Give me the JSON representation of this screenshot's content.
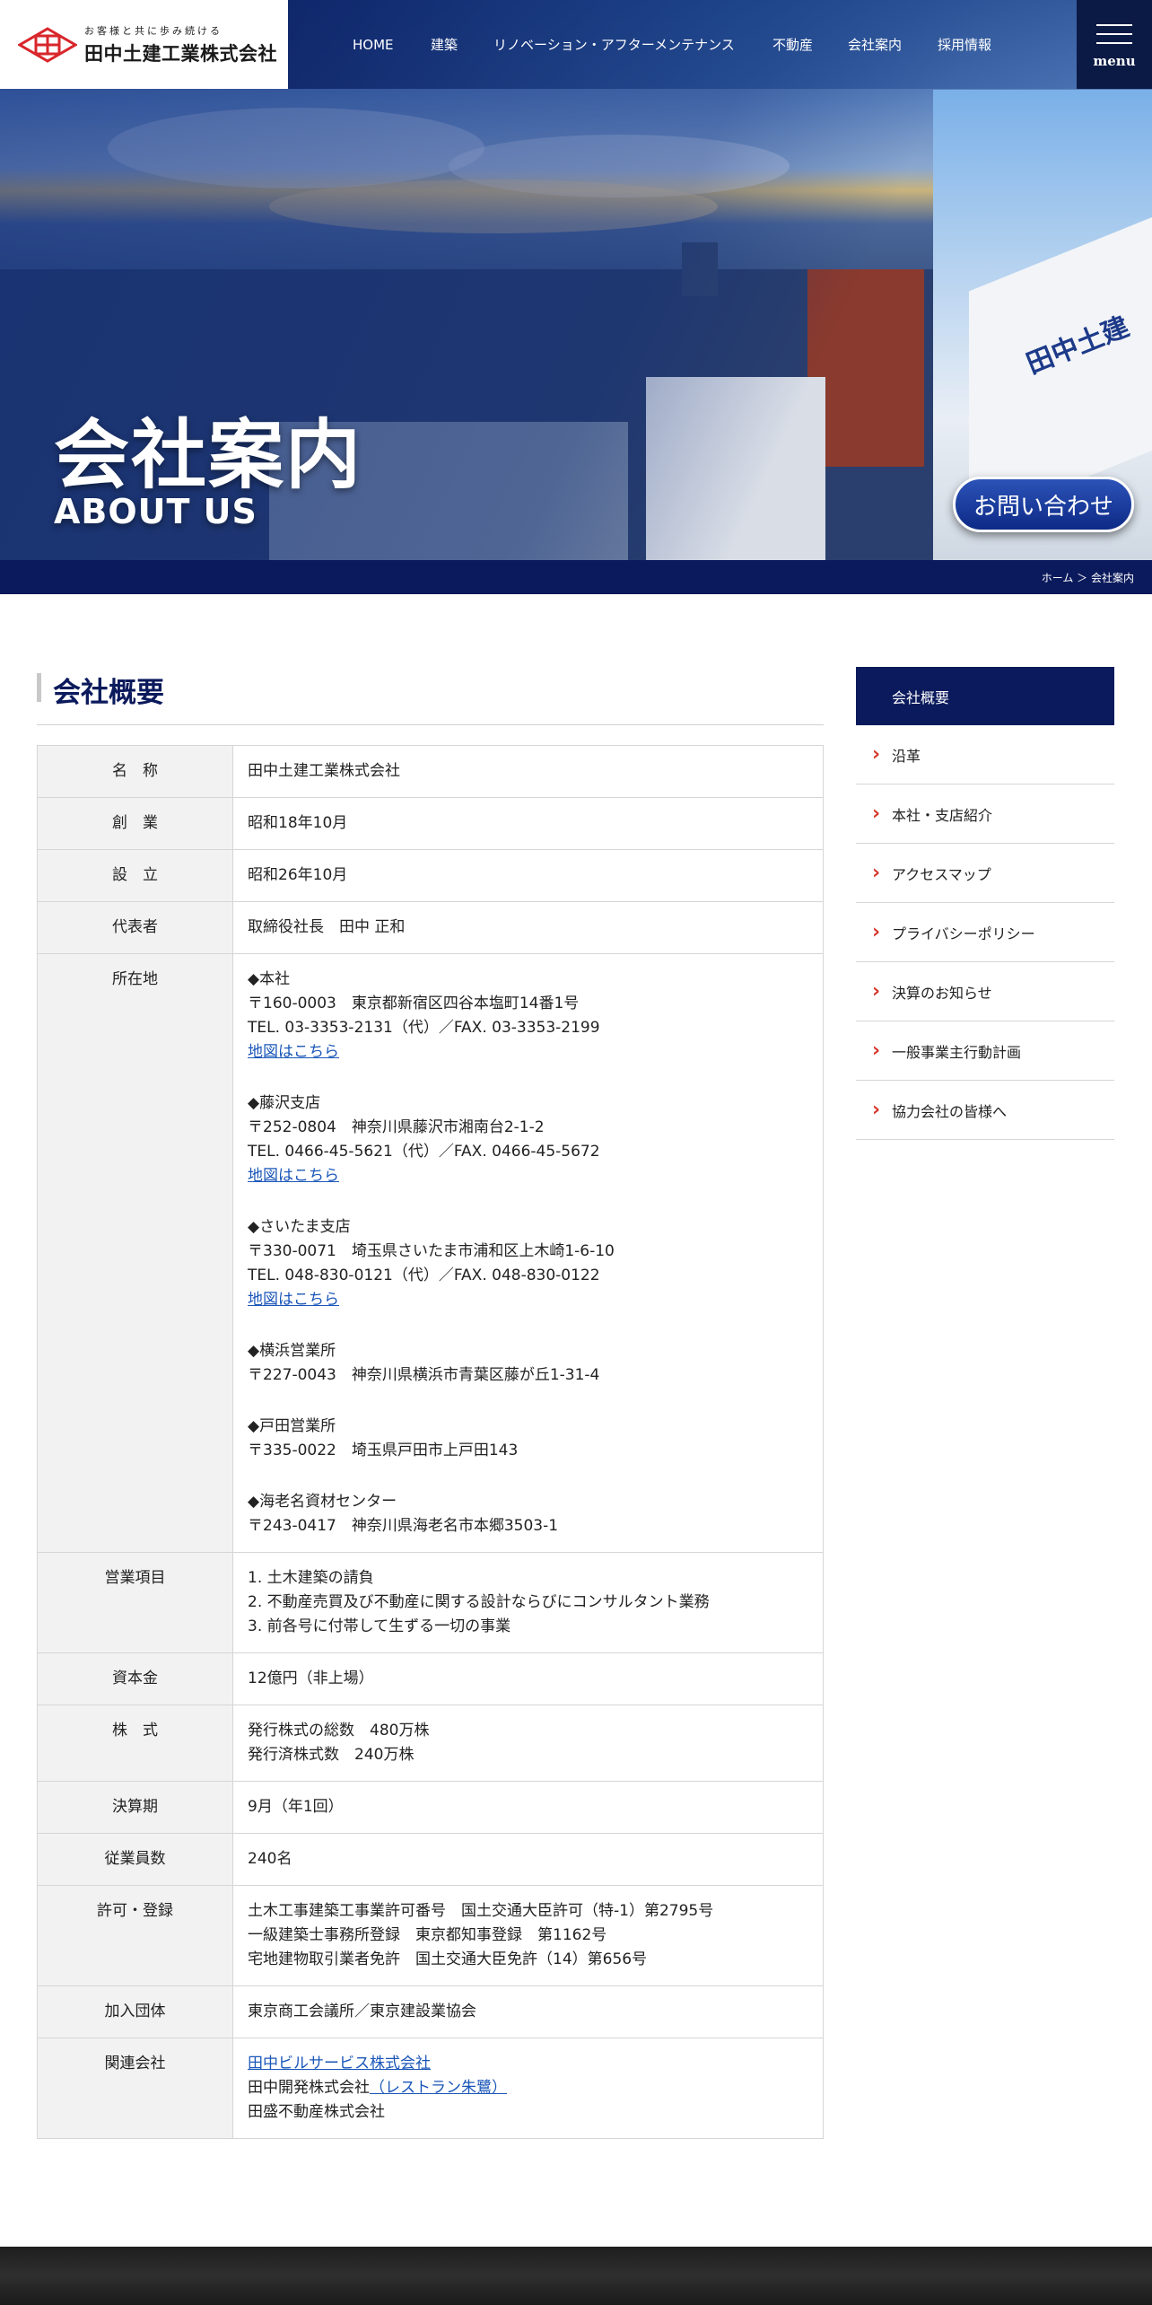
{
  "header": {
    "logo_tagline": "お客様と共に歩み続ける",
    "logo_name": "田中土建工業株式会社",
    "nav": [
      "HOME",
      "建築",
      "リノベーション・アフターメンテナンス",
      "不動産",
      "会社案内",
      "採用情報"
    ],
    "menu_label": "menu"
  },
  "hero": {
    "title_ja": "会社案内",
    "title_en": "ABOUT US",
    "building_sign": "田中土建",
    "contact_button": "お問い合わせ"
  },
  "breadcrumb": "ホーム ＞ 会社案内",
  "section_title": "会社概要",
  "table": {
    "name_label": "名　称",
    "name_value": "田中土建工業株式会社",
    "founded_label": "創　業",
    "founded_value": "昭和18年10月",
    "established_label": "設　立",
    "established_value": "昭和26年10月",
    "rep_label": "代表者",
    "rep_value": "取締役社長　田中 正和",
    "location_label": "所在地",
    "offices": [
      {
        "name": "◆本社",
        "zip": "〒160-0003　東京都新宿区四谷本塩町14番1号",
        "tel": "TEL. 03-3353-2131（代）／FAX. 03-3353-2199",
        "map": "地図はこちら"
      },
      {
        "name": "◆藤沢支店",
        "zip": "〒252-0804　神奈川県藤沢市湘南台2-1-2",
        "tel": "TEL. 0466-45-5621（代）／FAX. 0466-45-5672",
        "map": "地図はこちら"
      },
      {
        "name": "◆さいたま支店",
        "zip": "〒330-0071　埼玉県さいたま市浦和区上木崎1-6-10",
        "tel": "TEL. 048-830-0121（代）／FAX. 048-830-0122",
        "map": "地図はこちら"
      },
      {
        "name": "◆横浜営業所",
        "zip": "〒227-0043　神奈川県横浜市青葉区藤が丘1-31-4"
      },
      {
        "name": "◆戸田営業所",
        "zip": "〒335-0022　埼玉県戸田市上戸田143"
      },
      {
        "name": "◆海老名資材センター",
        "zip": "〒243-0417　神奈川県海老名市本郷3503-1"
      }
    ],
    "business_label": "営業項目",
    "business": [
      "1. 土木建築の請負",
      "2. 不動産売買及び不動産に関する設計ならびにコンサルタント業務",
      "3. 前各号に付帯して生ずる一切の事業"
    ],
    "capital_label": "資本金",
    "capital_value": "12億円（非上場）",
    "stock_label": "株　式",
    "stock": [
      "発行株式の総数　480万株",
      "発行済株式数　240万株"
    ],
    "fiscal_label": "決算期",
    "fiscal_value": "9月（年1回）",
    "employees_label": "従業員数",
    "employees_value": "240名",
    "license_label": "許可・登録",
    "licenses": [
      "土木工事建築工事業許可番号　国土交通大臣許可（特-1）第2795号",
      "一級建築士事務所登録　東京都知事登録　第1162号",
      "宅地建物取引業者免許　国土交通大臣免許（14）第656号"
    ],
    "assoc_label": "加入団体",
    "assoc_value": "東京商工会議所／東京建設業協会",
    "related_label": "関連会社",
    "related_link1": "田中ビルサービス株式会社",
    "related_text2": "田中開発株式会社",
    "related_link2": "（レストラン朱鷺）",
    "related_text3": "田盛不動産株式会社"
  },
  "sidebar": {
    "heading": "会社概要",
    "items": [
      "沿革",
      "本社・支店紹介",
      "アクセスマップ",
      "プライバシーポリシー",
      "決算のお知らせ",
      "一般事業主行動計画",
      "協力会社の皆様へ"
    ]
  },
  "colors": {
    "navy": "#0b1a5c",
    "link": "#1a56b8",
    "chevron": "#d8352a",
    "label_bg": "#f2f2f2"
  }
}
